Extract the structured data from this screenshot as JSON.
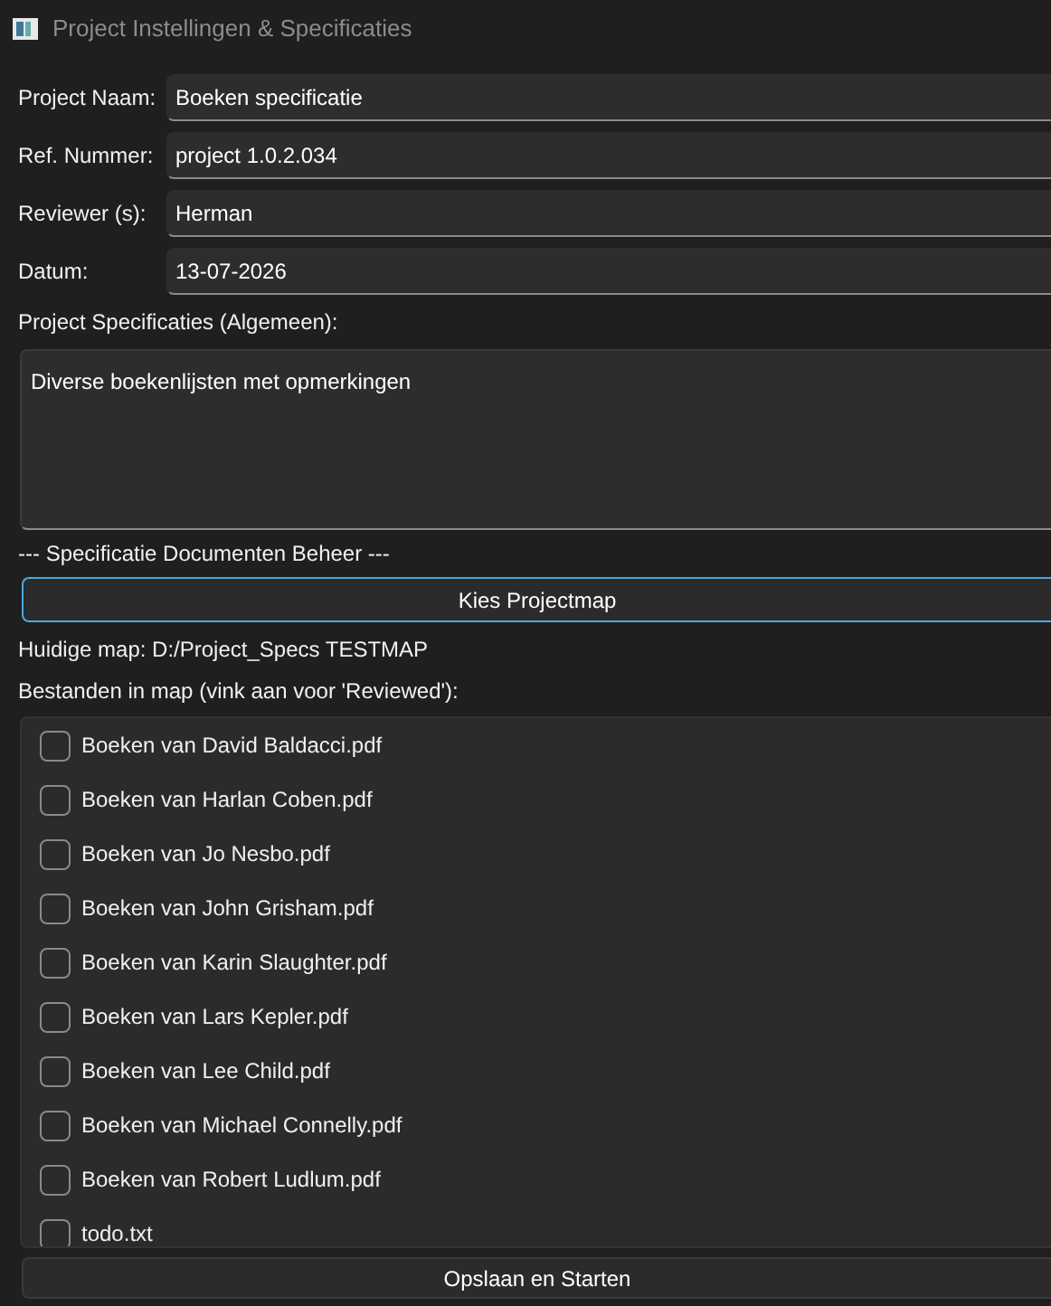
{
  "window": {
    "title": "Project Instellingen & Specificaties"
  },
  "fields": [
    {
      "label": "Project Naam:",
      "value": "Boeken specificatie"
    },
    {
      "label": "Ref. Nummer:",
      "value": "project 1.0.2.034"
    },
    {
      "label": "Reviewer (s):",
      "value": "Herman"
    },
    {
      "label": "Datum:",
      "value": "13-07-2026"
    }
  ],
  "specs": {
    "label": "Project Specificaties (Algemeen):",
    "value": "Diverse boekenlijsten met opmerkingen"
  },
  "section_title": "--- Specificatie Documenten Beheer ---",
  "choose_button": {
    "label": "Kies Projectmap",
    "focused": true
  },
  "current_folder": "Huidige map: D:/Project_Specs TESTMAP",
  "files_label": "Bestanden in map (vink aan voor 'Reviewed'):",
  "files": [
    {
      "name": "Boeken van David Baldacci.pdf",
      "checked": false
    },
    {
      "name": "Boeken van Harlan Coben.pdf",
      "checked": false
    },
    {
      "name": "Boeken van Jo Nesbo.pdf",
      "checked": false
    },
    {
      "name": "Boeken van John Grisham.pdf",
      "checked": false
    },
    {
      "name": "Boeken van Karin Slaughter.pdf",
      "checked": false
    },
    {
      "name": "Boeken van Lars Kepler.pdf",
      "checked": false
    },
    {
      "name": "Boeken van Lee Child.pdf",
      "checked": false
    },
    {
      "name": "Boeken van Michael Connelly.pdf",
      "checked": false
    },
    {
      "name": "Boeken van Robert Ludlum.pdf",
      "checked": false
    },
    {
      "name": "todo.txt",
      "checked": false
    }
  ],
  "save_button": {
    "label": "Opslaan en Starten"
  }
}
